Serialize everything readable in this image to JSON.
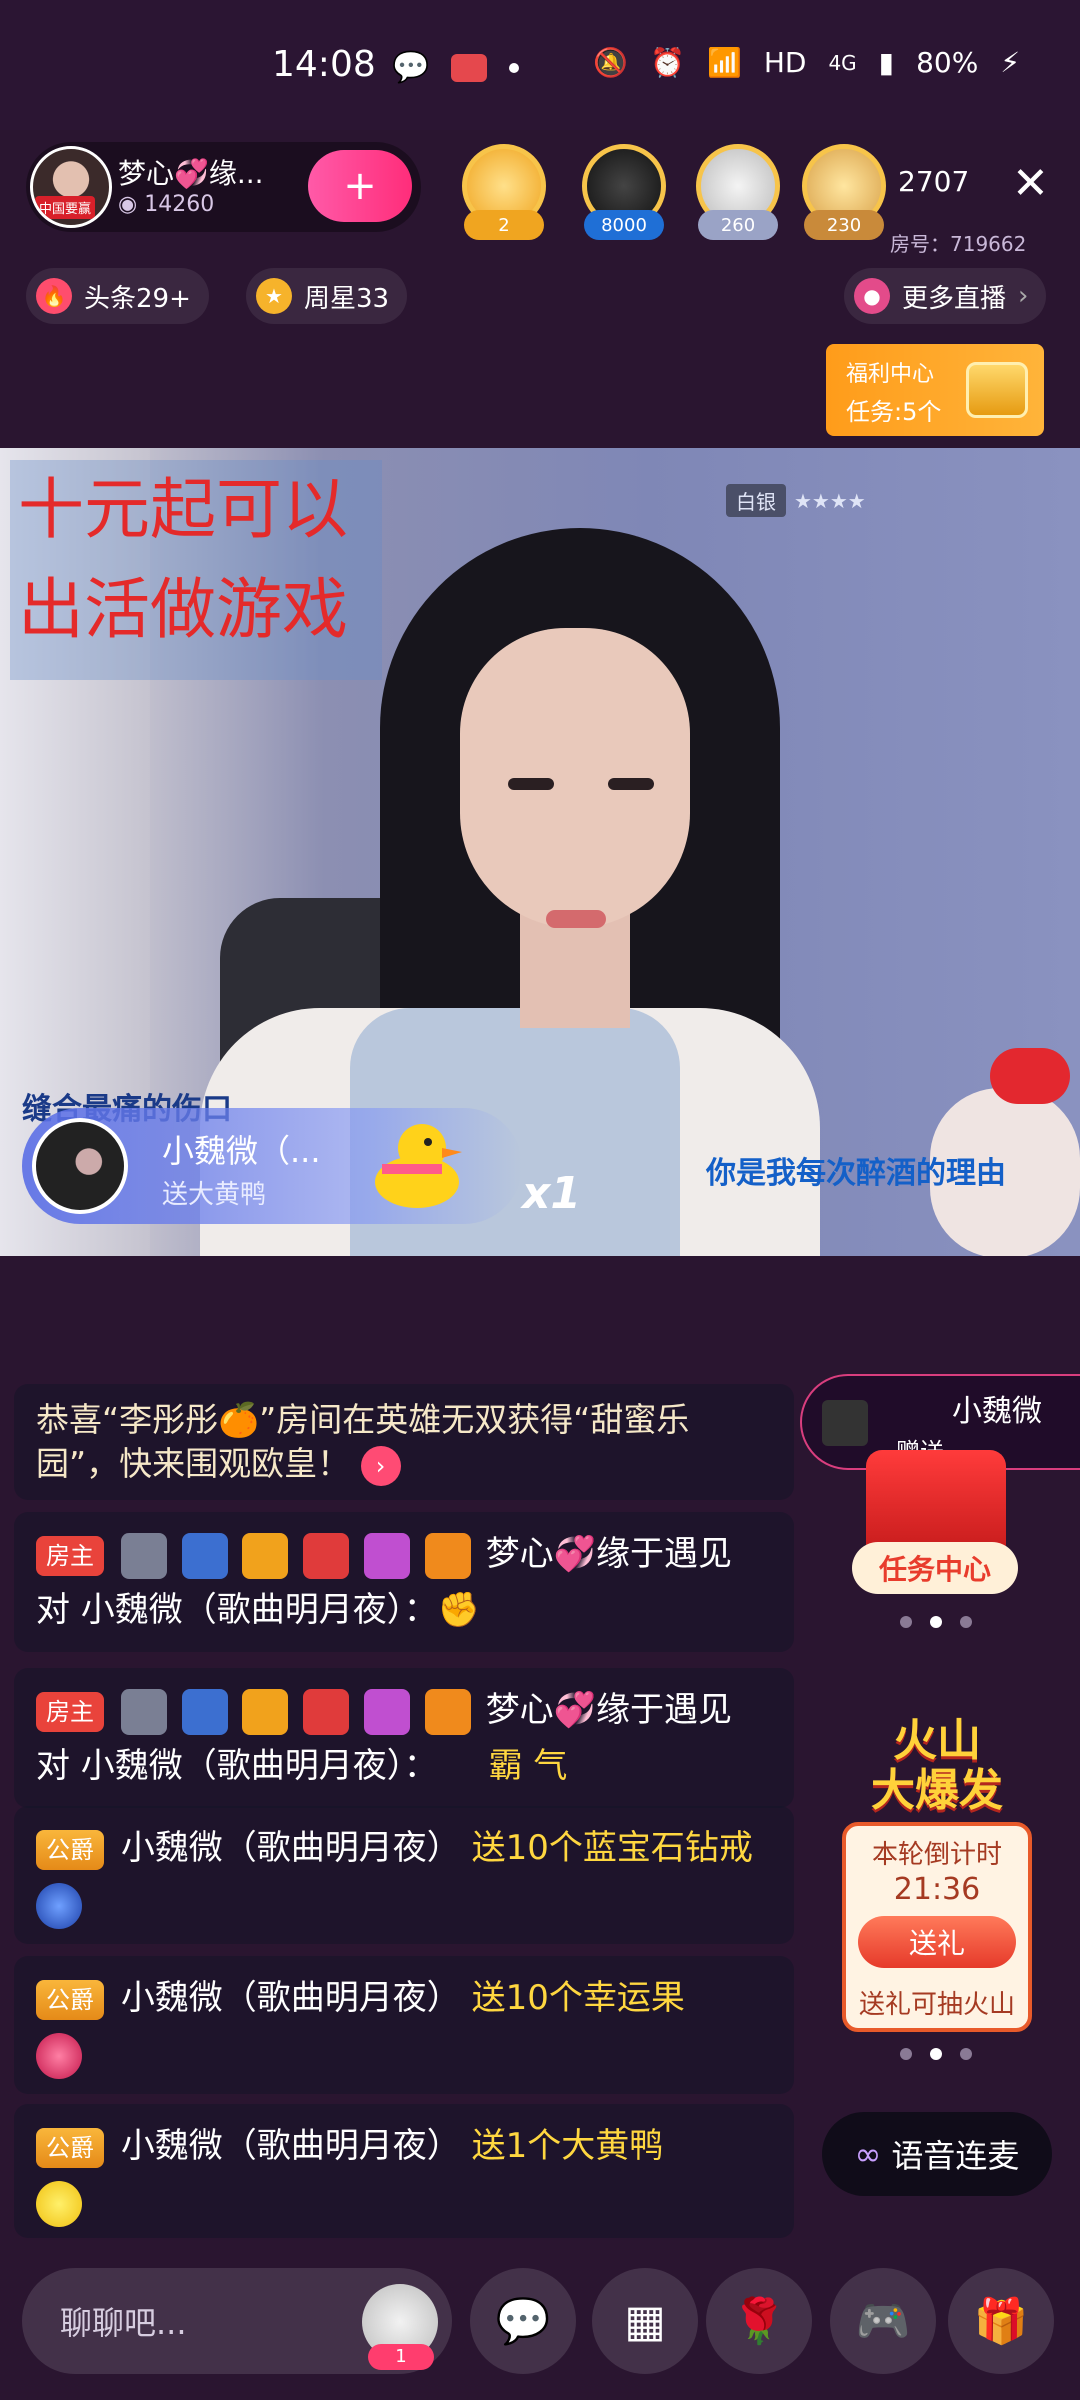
{
  "status_bar": {
    "time": "14:08",
    "network": "HD",
    "cell": "4G",
    "battery": "80%"
  },
  "host": {
    "name": "梦心💞缘...",
    "fans": "14260",
    "tag": "中国要赢"
  },
  "follow_symbol": "+",
  "top_rank": [
    {
      "count": "2",
      "color": "#f0a520"
    },
    {
      "count": "8000",
      "color": "#1f6fd6"
    },
    {
      "count": "260",
      "color": "#9aa3c6"
    },
    {
      "count": "230",
      "color": "#c98a3a"
    }
  ],
  "viewer_count": "2707",
  "close_symbol": "✕",
  "room_number": "房号：719662",
  "chips": {
    "headline": "头条29+",
    "weekly_star": "周星33",
    "more_live": "更多直播",
    "more_arrow": "›"
  },
  "welfare": {
    "title": "福利中心",
    "tasks": "任务:5个"
  },
  "video": {
    "promo_line1": "十元起可以",
    "promo_line2": "出活做游戏",
    "rank_label": "白银",
    "rank_stars": "★★★★",
    "song_left": "缝合最痛的伤口",
    "song_right": "你是我每次醉酒的理由"
  },
  "gift_banner": {
    "name": "小魏微（...",
    "action": "送大黄鸭",
    "count": "x1"
  },
  "chat": {
    "system_msg": "恭喜“李彤彤🍊”房间在英雄无双获得“甜蜜乐园”，快来围观欧皇！",
    "system_arrow": "›",
    "msg1": {
      "badge": "房主",
      "user": "梦心💞缘于遇见",
      "line2": "对 小魏微（歌曲明月夜）：✊"
    },
    "msg2": {
      "badge": "房主",
      "user": "梦心💞缘于遇见",
      "line2_prefix": "对 小魏微（歌曲明月夜）：",
      "line2_highlight": "霸 气"
    },
    "msg3": {
      "badge": "公爵",
      "user": "小魏微（歌曲明月夜）",
      "gift": "送10个蓝宝石钻戒"
    },
    "msg4": {
      "badge": "公爵",
      "user": "小魏微（歌曲明月夜）",
      "gift": "送10个幸运果"
    },
    "msg5": {
      "badge": "公爵",
      "user": "小魏微（歌曲明月夜）",
      "gift": "送1个大黄鸭"
    }
  },
  "gift_chip": {
    "name": "小魏微",
    "action": "赠送"
  },
  "task_center": "任务中心",
  "volcano": {
    "title_line1": "火山",
    "title_line2": "大爆发",
    "countdown_label": "本轮倒计时",
    "countdown": "21:36",
    "button": "送礼",
    "tip": "送礼可抽火山"
  },
  "voice_link": "语音连麦",
  "bottom": {
    "placeholder": "聊聊吧...",
    "mini_count": "1"
  }
}
